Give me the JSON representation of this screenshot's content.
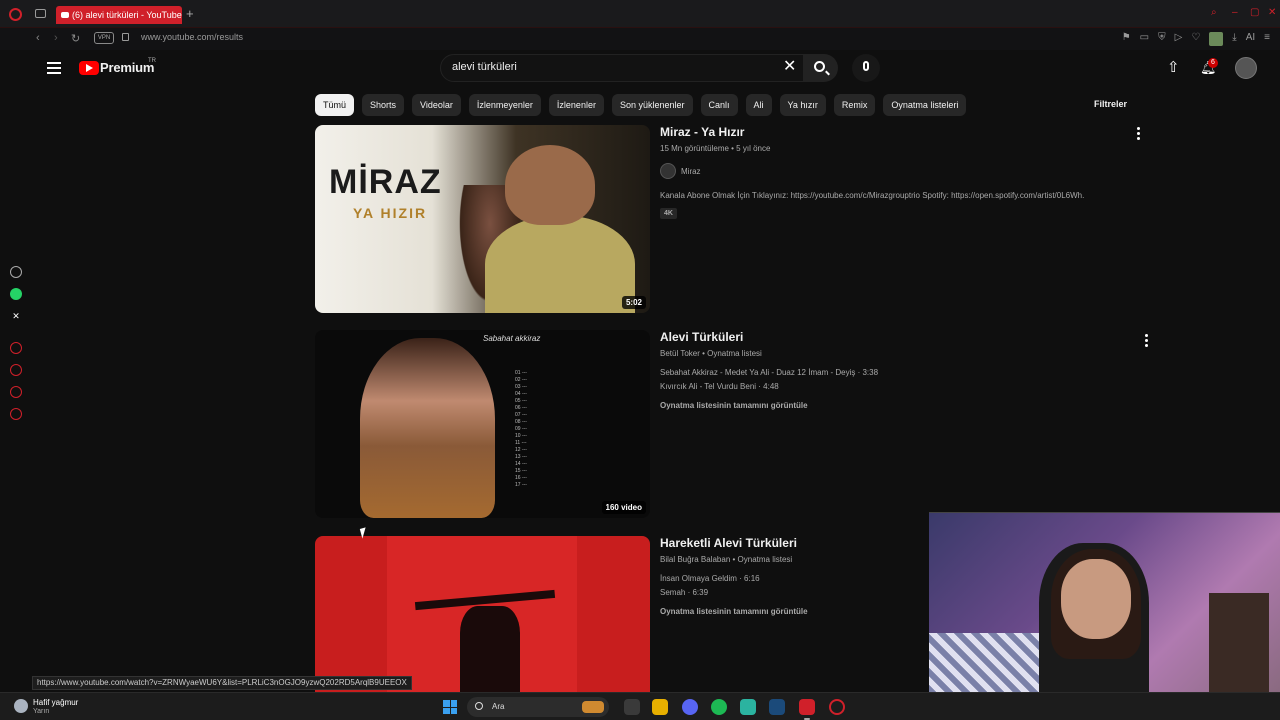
{
  "browser": {
    "tab_title": "(6) alevi türküleri - YouTube",
    "new_tab": "+",
    "vpn": "VPN",
    "url": "www.youtube.com/results",
    "ai_label": "AI"
  },
  "header": {
    "brand": "Premium",
    "region": "TR",
    "search_value": "alevi türküleri",
    "notification_count": "6"
  },
  "chips": [
    "Tümü",
    "Shorts",
    "Videolar",
    "İzlenmeyenler",
    "İzlenenler",
    "Son yüklenenler",
    "Canlı",
    "Ali",
    "Ya hızır",
    "Remix",
    "Oynatma listeleri"
  ],
  "filters_label": "Filtreler",
  "results": [
    {
      "title": "Miraz - Ya Hızır",
      "meta": "15 Mn görüntüleme • 5 yıl önce",
      "channel": "Miraz",
      "description": "Kanala Abone Olmak İçin Tıklayınız: https://youtube.com/c/Mirazgrouptrio Spotify: https://open.spotify.com/artist/0L6Wh.",
      "badge": "4K",
      "duration": "5:02",
      "thumb_title": "MİRAZ",
      "thumb_subtitle": "YA HIZIR"
    },
    {
      "title": "Alevi Türküleri",
      "meta": "Betül Toker • Oynatma listesi",
      "lines": [
        "Sebahat Akkiraz - Medet Ya Ali - Duaz 12 İmam - Deyiş · 3:38",
        "Kıvırcık Ali - Tel Vurdu Beni · 4:48"
      ],
      "view_all": "Oynatma listesinin tamamını görüntüle",
      "count": "160 video",
      "thumb_head": "Sabahat akkiraz"
    },
    {
      "title": "Hareketli Alevi Türküleri",
      "meta": "Bilal Buğra Balaban • Oynatma listesi",
      "lines": [
        "İnsan Olmaya Geldim · 6:16",
        "Semah · 6:39"
      ],
      "view_all": "Oynatma listesinin tamamını görüntüle"
    }
  ],
  "status_url": "https://www.youtube.com/watch?v=ZRNWyaeWU6Y&list=PLRLiC3nOGJO9yzwQ202RD5ArqlB9UEEOX",
  "taskbar": {
    "weather_title": "Hafif yağmur",
    "weather_sub": "Yarın",
    "search_label": "Ara"
  },
  "colors": {
    "accent": "#ff0000",
    "opera": "#d0202a",
    "background": "#0f0f0f"
  }
}
